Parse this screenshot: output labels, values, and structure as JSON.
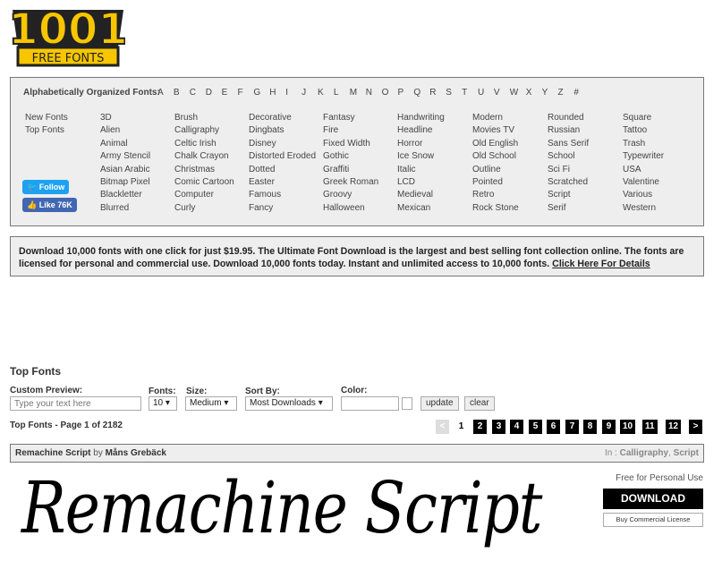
{
  "logo": {
    "text_top": "1001",
    "text_bottom": "FREE FONTS"
  },
  "alphabet": {
    "label": "Alphabetically Organized Fonts:",
    "letters": [
      "A",
      "B",
      "C",
      "D",
      "E",
      "F",
      "G",
      "H",
      "I",
      "J",
      "K",
      "L",
      "M",
      "N",
      "O",
      "P",
      "Q",
      "R",
      "S",
      "T",
      "U",
      "V",
      "W",
      "X",
      "Y",
      "Z",
      "#"
    ]
  },
  "quick_links": [
    "New Fonts",
    "Top Fonts"
  ],
  "social": {
    "follow": "Follow",
    "like": "Like 76K"
  },
  "categories": [
    [
      "3D",
      "Alien",
      "Animal",
      "Army Stencil",
      "Asian Arabic",
      "Bitmap Pixel",
      "Blackletter",
      "Blurred"
    ],
    [
      "Brush",
      "Calligraphy",
      "Celtic Irish",
      "Chalk Crayon",
      "Christmas",
      "Comic Cartoon",
      "Computer",
      "Curly"
    ],
    [
      "Decorative",
      "Dingbats",
      "Disney",
      "Distorted Eroded",
      "Dotted",
      "Easter",
      "Famous",
      "Fancy"
    ],
    [
      "Fantasy",
      "Fire",
      "Fixed Width",
      "Gothic",
      "Graffiti",
      "Greek Roman",
      "Groovy",
      "Halloween"
    ],
    [
      "Handwriting",
      "Headline",
      "Horror",
      "Ice Snow",
      "Italic",
      "LCD",
      "Medieval",
      "Mexican"
    ],
    [
      "Modern",
      "Movies TV",
      "Old English",
      "Old School",
      "Outline",
      "Pointed",
      "Retro",
      "Rock Stone"
    ],
    [
      "Rounded",
      "Russian",
      "Sans Serif",
      "School",
      "Sci Fi",
      "Scratched",
      "Script",
      "Serif"
    ],
    [
      "Square",
      "Tattoo",
      "Trash",
      "Typewriter",
      "USA",
      "Valentine",
      "Various",
      "Western"
    ]
  ],
  "ad": {
    "text": "Download 10,000 fonts with one click for just $19.95. The Ultimate Font Download is the largest and best selling font collection online. The fonts are licensed for personal and commercial use. Download 10,000 fonts today. Instant and unlimited access to 10,000 fonts. ",
    "link": "Click Here For Details"
  },
  "top_fonts": {
    "title": "Top Fonts",
    "custom_preview_label": "Custom Preview:",
    "custom_preview_placeholder": "Type your text here",
    "fonts_label": "Fonts:",
    "fonts_value": "10",
    "size_label": "Size:",
    "size_value": "Medium",
    "sort_label": "Sort By:",
    "sort_value": "Most Downloads",
    "color_label": "Color:",
    "color_value": "",
    "update": "update",
    "clear": "clear",
    "page_info": "Top Fonts - Page 1 of 2182",
    "pages": [
      "2",
      "3",
      "4",
      "5",
      "6",
      "7",
      "8",
      "9",
      "10",
      "11",
      "12"
    ],
    "current_page": "1",
    "prev": "<",
    "next": ">"
  },
  "font_item": {
    "name": "Remachine Script",
    "by": " by ",
    "author": "Måns Grebäck",
    "in_label": "In : ",
    "cat1": "Calligraphy",
    "sep": ", ",
    "cat2": "Script",
    "license": "Free for Personal Use",
    "download": "DOWNLOAD",
    "commercial": "Buy Commercial License",
    "preview_text": "Remachine Script"
  },
  "colors": {
    "logo_yellow": "#f7c600",
    "twitter": "#1da1f2",
    "facebook": "#4267b2",
    "pager": "#000000"
  }
}
